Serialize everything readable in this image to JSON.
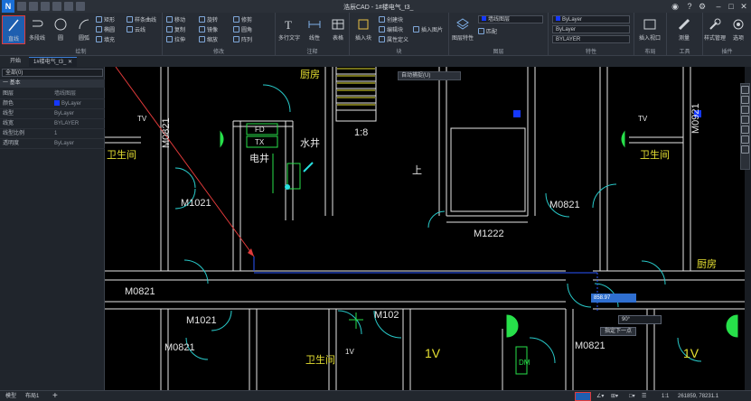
{
  "app": {
    "title": "浩辰CAD - 1#楼电气_t3_"
  },
  "ribbon": {
    "groups": [
      "绘制",
      "修改",
      "注释",
      "块",
      "图层",
      "特性",
      "布局",
      "工具",
      "插件"
    ],
    "big": [
      "直线",
      "多段线",
      "圆",
      "圆弧",
      "多行文字",
      "线性",
      "表格",
      "插入块",
      "图层特性",
      "匹配",
      "插入视口",
      "测量",
      "样式管理",
      "选项"
    ],
    "small": [
      "移动",
      "复制",
      "拉伸",
      "镜像",
      "旋转",
      "修剪",
      "缩放",
      "阵列",
      "圆角",
      "创建块",
      "编辑块",
      "属性定义",
      "矩形",
      "椭圆",
      "填充",
      "样条曲线",
      "云线",
      "插入图片"
    ],
    "bylayer": [
      "ByLayer",
      "ByLayer",
      "BYLAYER"
    ]
  },
  "tabs": {
    "start": "开始",
    "drawing": "1#楼电气_t3_"
  },
  "props": {
    "layer": "全部(0)",
    "section": "一 基本",
    "rows": [
      {
        "k": "图层",
        "v": "墙线图层"
      },
      {
        "k": "颜色",
        "v": "ByLayer"
      },
      {
        "k": "线型",
        "v": "ByLayer"
      },
      {
        "k": "线宽",
        "v": "BYLAYER"
      },
      {
        "k": "线型比例",
        "v": "1"
      },
      {
        "k": "透明度",
        "v": "ByLayer"
      }
    ]
  },
  "hint": "自动捕捉(U)",
  "input": {
    "length": "858.97",
    "angle": "90°",
    "next": "指定下一点"
  },
  "drawing_labels": {
    "elev": "电井",
    "water": "水井",
    "fd": "FD",
    "tx": "TX",
    "stair": "1:8",
    "up": "上",
    "kitchen": "厨房",
    "bath": "卫生间",
    "doors": [
      "M1021",
      "M0821",
      "M1222",
      "M0821",
      "M1021",
      "M0821",
      "M102"
    ],
    "tv": "TV",
    "onev": "1V",
    "m0921": "M0921",
    "dm": "DM"
  },
  "status": {
    "model": "模型",
    "layout": "布局1",
    "add": "+",
    "scale": "1:1",
    "coords": "261859, 78231.1"
  }
}
